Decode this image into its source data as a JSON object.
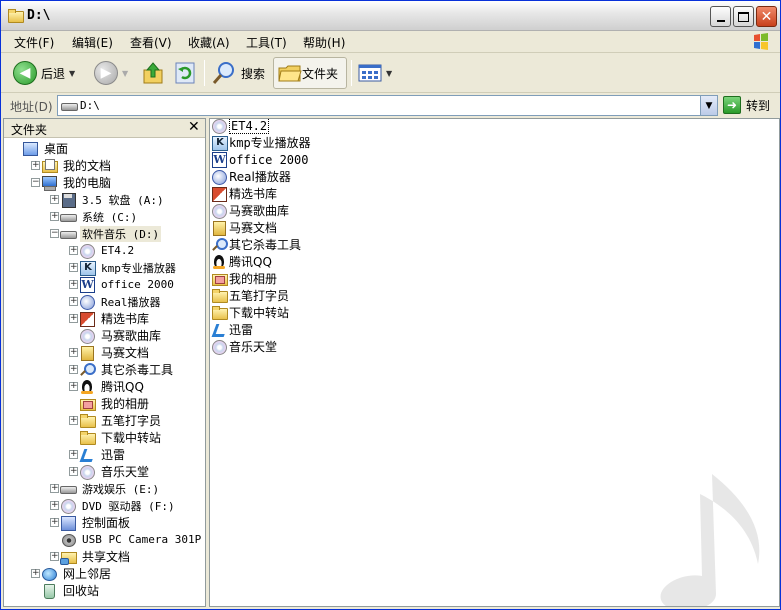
{
  "window": {
    "title": "D:\\"
  },
  "menu": {
    "file": "文件(F)",
    "edit": "编辑(E)",
    "view": "查看(V)",
    "favorites": "收藏(A)",
    "tools": "工具(T)",
    "help": "帮助(H)"
  },
  "toolbar": {
    "back_label": "后退",
    "search_label": "搜索",
    "folders_label": "文件夹"
  },
  "address": {
    "label": "地址(D)",
    "value": "D:\\",
    "go_label": "转到"
  },
  "folder_pane": {
    "title": "文件夹",
    "tree": [
      {
        "label": "桌面",
        "icon": "desktop-icon"
      },
      {
        "label": "我的文档",
        "icon": "my-documents-icon",
        "expander": "+"
      },
      {
        "label": "我的电脑",
        "icon": "my-computer-icon",
        "expander": "-"
      },
      {
        "label": "3.5 软盘 (A:)",
        "icon": "floppy-icon",
        "expander": "+"
      },
      {
        "label": "系统 (C:)",
        "icon": "drive-icon",
        "expander": "+"
      },
      {
        "label": "软件音乐 (D:)",
        "icon": "drive-icon",
        "expander": "-",
        "selected": true
      },
      {
        "label": "ET4.2",
        "icon": "et-icon",
        "expander": "+"
      },
      {
        "label": "kmp专业播放器",
        "icon": "kmp-icon",
        "expander": "+"
      },
      {
        "label": "office 2000",
        "icon": "word-icon",
        "expander": "+"
      },
      {
        "label": "Real播放器",
        "icon": "real-icon",
        "expander": "+"
      },
      {
        "label": "精选书库",
        "icon": "book-icon",
        "expander": "+"
      },
      {
        "label": "马赛歌曲库",
        "icon": "cd-icon"
      },
      {
        "label": "马赛文档",
        "icon": "docs-folder-icon",
        "expander": "+"
      },
      {
        "label": "其它杀毒工具",
        "icon": "magnifier-icon",
        "expander": "+"
      },
      {
        "label": "腾讯QQ",
        "icon": "qq-penguin-icon",
        "expander": "+"
      },
      {
        "label": "我的相册",
        "icon": "album-icon"
      },
      {
        "label": "五笔打字员",
        "icon": "folder-icon",
        "expander": "+"
      },
      {
        "label": "下载中转站",
        "icon": "folder-icon"
      },
      {
        "label": "迅雷",
        "icon": "thunder-icon",
        "expander": "+"
      },
      {
        "label": "音乐天堂",
        "icon": "cd-icon",
        "expander": "+"
      },
      {
        "label": "游戏娱乐 (E:)",
        "icon": "drive-icon",
        "expander": "+"
      },
      {
        "label": "DVD 驱动器 (F:)",
        "icon": "dvd-icon",
        "expander": "+"
      },
      {
        "label": "控制面板",
        "icon": "control-panel-icon",
        "expander": "+"
      },
      {
        "label": "USB PC Camera 301P",
        "icon": "camera-icon"
      },
      {
        "label": "共享文档",
        "icon": "shared-docs-icon",
        "expander": "+"
      },
      {
        "label": "网上邻居",
        "icon": "network-icon",
        "expander": "+"
      },
      {
        "label": "回收站",
        "icon": "recycle-bin-icon"
      }
    ]
  },
  "content": {
    "items": [
      {
        "label": "ET4.2",
        "icon": "et-icon",
        "focused": true
      },
      {
        "label": "kmp专业播放器",
        "icon": "kmp-icon"
      },
      {
        "label": "office 2000",
        "icon": "word-icon"
      },
      {
        "label": "Real播放器",
        "icon": "real-icon"
      },
      {
        "label": "精选书库",
        "icon": "book-icon"
      },
      {
        "label": "马赛歌曲库",
        "icon": "cd-icon"
      },
      {
        "label": "马赛文档",
        "icon": "docs-folder-icon"
      },
      {
        "label": "其它杀毒工具",
        "icon": "magnifier-icon"
      },
      {
        "label": "腾讯QQ",
        "icon": "qq-penguin-icon"
      },
      {
        "label": "我的相册",
        "icon": "album-icon"
      },
      {
        "label": "五笔打字员",
        "icon": "folder-icon"
      },
      {
        "label": "下载中转站",
        "icon": "folder-icon"
      },
      {
        "label": "迅雷",
        "icon": "thunder-icon"
      },
      {
        "label": "音乐天堂",
        "icon": "cd-icon"
      }
    ]
  }
}
